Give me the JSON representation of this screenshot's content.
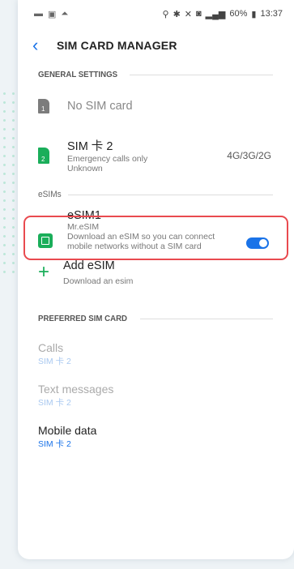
{
  "status_bar": {
    "battery": "60%",
    "time": "13:37"
  },
  "header": {
    "back_icon": "chevron-left-icon",
    "title": "SIM CARD MANAGER"
  },
  "general": {
    "header": "GENERAL SETTINGS",
    "sim1": {
      "label": "No SIM card",
      "badge": "1"
    },
    "sim2": {
      "label": "SIM 卡 2",
      "badge": "2",
      "line1": "Emergency calls only",
      "line2": "Unknown",
      "network": "4G/3G/2G"
    }
  },
  "esims": {
    "header": "eSIMs",
    "esim1": {
      "label": "eSIM1",
      "carrier": "Mr.eSIM",
      "desc1": "Download an eSIM so you can connect",
      "desc2": "mobile networks without a SIM card",
      "enabled": true
    },
    "add": {
      "label": "Add eSIM",
      "sub": "Download an esim"
    }
  },
  "preferred": {
    "header": "PREFERRED SIM CARD",
    "calls": {
      "label": "Calls",
      "value": "SIM 卡 2"
    },
    "texts": {
      "label": "Text messages",
      "value": "SIM 卡 2"
    },
    "data": {
      "label": "Mobile data",
      "value": "SIM 卡 2"
    }
  },
  "colors": {
    "accent": "#1a73e8",
    "green": "#1aae5a",
    "highlight": "#e94a4f"
  }
}
